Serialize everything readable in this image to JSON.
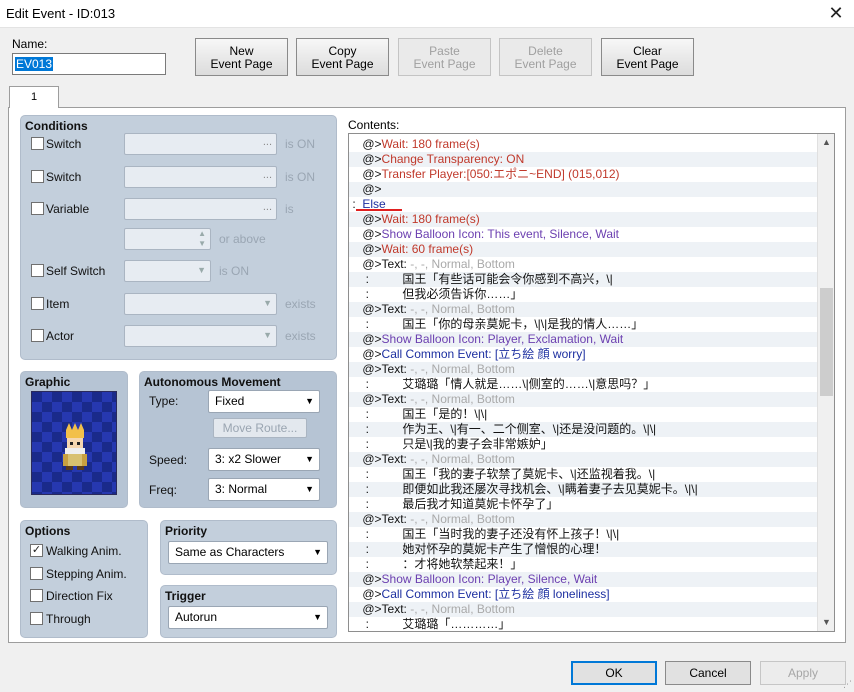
{
  "window": {
    "title": "Edit Event - ID:013",
    "close_icon": "close-icon"
  },
  "name": {
    "label": "Name:",
    "value": "EV013"
  },
  "toolbar": {
    "new": "New\nEvent Page",
    "copy": "Copy\nEvent Page",
    "paste": "Paste\nEvent Page",
    "delete": "Delete\nEvent Page",
    "clear": "Clear\nEvent Page"
  },
  "page_tab": "1",
  "conditions": {
    "title": "Conditions",
    "switch1": {
      "label": "Switch",
      "suffix": "is ON"
    },
    "switch2": {
      "label": "Switch",
      "suffix": "is ON"
    },
    "variable": {
      "label": "Variable",
      "suffix": "is",
      "or_above": "or above"
    },
    "self_switch": {
      "label": "Self Switch",
      "suffix": "is ON"
    },
    "item": {
      "label": "Item",
      "suffix": "exists"
    },
    "actor": {
      "label": "Actor",
      "suffix": "exists"
    },
    "dots": "..."
  },
  "graphic": {
    "title": "Graphic",
    "sprite": "character-sprite"
  },
  "autonomous": {
    "title": "Autonomous Movement",
    "type_label": "Type:",
    "type_value": "Fixed",
    "move_route": "Move Route...",
    "speed_label": "Speed:",
    "speed_value": "3: x2 Slower",
    "freq_label": "Freq:",
    "freq_value": "3: Normal"
  },
  "options": {
    "title": "Options",
    "walking": {
      "label": "Walking Anim.",
      "checked": true
    },
    "stepping": {
      "label": "Stepping Anim.",
      "checked": false
    },
    "direction": {
      "label": "Direction Fix",
      "checked": false
    },
    "through": {
      "label": "Through",
      "checked": false
    }
  },
  "priority": {
    "title": "Priority",
    "value": "Same as Characters"
  },
  "trigger": {
    "title": "Trigger",
    "value": "Autorun"
  },
  "contents": {
    "label": "Contents:",
    "lines": [
      {
        "p": "    @>",
        "t": "Wait: 180 frame(s)",
        "c": "red"
      },
      {
        "p": "    @>",
        "t": "Change Transparency: ON",
        "c": "red"
      },
      {
        "p": "    @>",
        "t": "Transfer Player:[050:エポニ~END] (015,012)",
        "c": "red"
      },
      {
        "p": "    @>",
        "t": "",
        "c": "blk"
      },
      {
        "p": " :  ",
        "t": "Else",
        "c": "blue"
      },
      {
        "p": "    @>",
        "t": "Wait: 180 frame(s)",
        "c": "red"
      },
      {
        "p": "    @>",
        "t": "Show Balloon Icon: This event, Silence, Wait",
        "c": "purple"
      },
      {
        "p": "    @>",
        "t": "Wait: 60 frame(s)",
        "c": "red"
      },
      {
        "p": "    @>",
        "t": "Text: -, -, Normal, Bottom",
        "c": "gray",
        "pre": "Text:"
      },
      {
        "p": "     :          ",
        "t": "国王「有些话可能会令你感到不高兴，\\|",
        "c": "blk"
      },
      {
        "p": "     :          ",
        "t": "但我必须告诉你……」",
        "c": "blk"
      },
      {
        "p": "    @>",
        "t": "Text: -, -, Normal, Bottom",
        "c": "gray",
        "pre": "Text:"
      },
      {
        "p": "     :          ",
        "t": "国王「你的母亲莫妮卡，\\|\\|是我的情人……」",
        "c": "blk"
      },
      {
        "p": "    @>",
        "t": "Show Balloon Icon: Player, Exclamation, Wait",
        "c": "purple"
      },
      {
        "p": "    @>",
        "t": "Call Common Event: [立ち絵 顔 worry]",
        "c": "blue"
      },
      {
        "p": "    @>",
        "t": "Text: -, -, Normal, Bottom",
        "c": "gray",
        "pre": "Text:"
      },
      {
        "p": "     :          ",
        "t": "艾璐璐「情人就是……\\|侧室的……\\|意思吗？」",
        "c": "blk"
      },
      {
        "p": "    @>",
        "t": "Text: -, -, Normal, Bottom",
        "c": "gray",
        "pre": "Text:"
      },
      {
        "p": "     :          ",
        "t": "国王「是的！\\|\\|",
        "c": "blk"
      },
      {
        "p": "     :          ",
        "t": "作为王、\\|有一、二个侧室、\\|还是没问题的。\\|\\|",
        "c": "blk"
      },
      {
        "p": "     :          ",
        "t": "只是\\|我的妻子会非常嫉妒」",
        "c": "blk"
      },
      {
        "p": "    @>",
        "t": "Text: -, -, Normal, Bottom",
        "c": "gray",
        "pre": "Text:"
      },
      {
        "p": "     :          ",
        "t": "国王「我的妻子软禁了莫妮卡、\\|还监视着我。\\|",
        "c": "blk"
      },
      {
        "p": "     :          ",
        "t": "即便如此我还屡次寻找机会、\\|瞒着妻子去见莫妮卡。\\|\\|",
        "c": "blk"
      },
      {
        "p": "     :          ",
        "t": "最后我才知道莫妮卡怀孕了」",
        "c": "blk"
      },
      {
        "p": "    @>",
        "t": "Text: -, -, Normal, Bottom",
        "c": "gray",
        "pre": "Text:"
      },
      {
        "p": "     :          ",
        "t": "国王「当时我的妻子还没有怀上孩子！\\|\\|",
        "c": "blk"
      },
      {
        "p": "     :          ",
        "t": "她对怀孕的莫妮卡产生了憎恨的心理！",
        "c": "blk"
      },
      {
        "p": "     :          ",
        "t": "：才将她软禁起来！」",
        "c": "blk"
      },
      {
        "p": "    @>",
        "t": "Show Balloon Icon: Player, Silence, Wait",
        "c": "purple"
      },
      {
        "p": "    @>",
        "t": "Call Common Event: [立ち絵 顔 loneliness]",
        "c": "blue"
      },
      {
        "p": "    @>",
        "t": "Text: -, -, Normal, Bottom",
        "c": "gray",
        "pre": "Text:"
      },
      {
        "p": "     :          ",
        "t": "艾璐璐「…………」",
        "c": "blk"
      }
    ]
  },
  "dialog": {
    "ok": "OK",
    "cancel": "Cancel",
    "apply": "Apply"
  },
  "colors": {
    "accent": "#0078d7",
    "panel": "#c3cfdc",
    "command_red": "#c0392b",
    "else_blue": "#1c2fa0"
  }
}
